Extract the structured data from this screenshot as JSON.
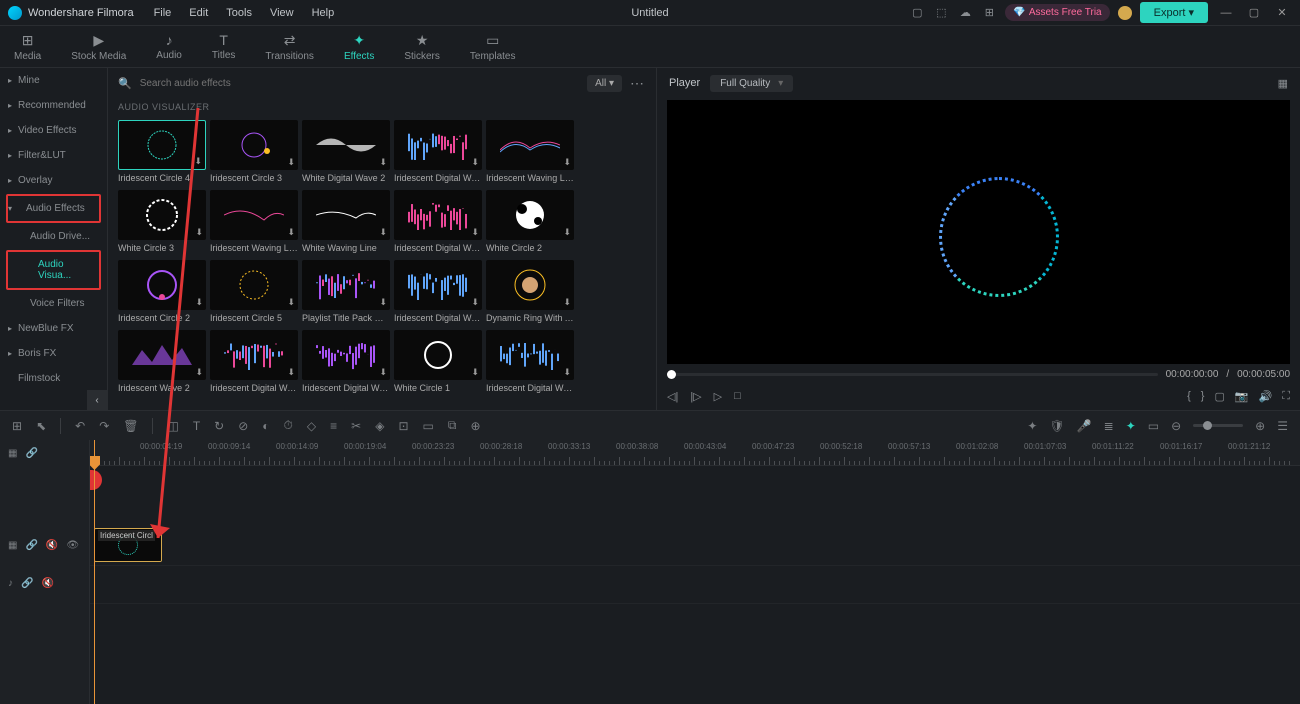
{
  "app": {
    "name": "Wondershare Filmora",
    "title": "Untitled"
  },
  "menu": [
    "File",
    "Edit",
    "Tools",
    "View",
    "Help"
  ],
  "titleRight": {
    "assets": "Assets Free Tria",
    "export": "Export"
  },
  "toolTabs": [
    {
      "label": "Media",
      "icon": "⊞"
    },
    {
      "label": "Stock Media",
      "icon": "▶"
    },
    {
      "label": "Audio",
      "icon": "♪"
    },
    {
      "label": "Titles",
      "icon": "T"
    },
    {
      "label": "Transitions",
      "icon": "⇄"
    },
    {
      "label": "Effects",
      "icon": "✦",
      "active": true
    },
    {
      "label": "Stickers",
      "icon": "★"
    },
    {
      "label": "Templates",
      "icon": "▭"
    }
  ],
  "sidebar": {
    "items": [
      {
        "label": "Mine",
        "expandable": true
      },
      {
        "label": "Recommended",
        "expandable": true
      },
      {
        "label": "Video Effects",
        "expandable": true
      },
      {
        "label": "Filter&LUT",
        "expandable": true
      },
      {
        "label": "Overlay",
        "expandable": true
      },
      {
        "label": "Audio Effects",
        "expandable": true,
        "expanded": true,
        "highlighted": true
      },
      {
        "label": "Audio Drive...",
        "sub": true
      },
      {
        "label": "Audio Visua...",
        "sub": true,
        "selected": true,
        "highlighted": true
      },
      {
        "label": "Voice Filters",
        "sub": true
      },
      {
        "label": "NewBlue FX",
        "expandable": true
      },
      {
        "label": "Boris FX",
        "expandable": true
      },
      {
        "label": "Filmstock"
      }
    ]
  },
  "browser": {
    "searchPlaceholder": "Search audio effects",
    "filterAll": "All",
    "sectionLabel": "AUDIO VISUALIZER",
    "items": [
      {
        "label": "Iridescent Circle 4",
        "selected": true
      },
      {
        "label": "Iridescent Circle 3"
      },
      {
        "label": "White  Digital Wave 2"
      },
      {
        "label": "Iridescent Digital Wav..."
      },
      {
        "label": "Iridescent Waving Line..."
      },
      {
        "label": "White Circle 3"
      },
      {
        "label": "Iridescent Waving Line..."
      },
      {
        "label": "White Waving Line"
      },
      {
        "label": "Iridescent Digital Wav..."
      },
      {
        "label": "White Circle 2"
      },
      {
        "label": "Iridescent Circle 2"
      },
      {
        "label": "Iridescent Circle 5"
      },
      {
        "label": "Playlist Title Pack Musi..."
      },
      {
        "label": "Iridescent Digital Wav..."
      },
      {
        "label": "Dynamic Ring With Ai ..."
      },
      {
        "label": "Iridescent Wave 2"
      },
      {
        "label": "Iridescent Digital Wav..."
      },
      {
        "label": "Iridescent Digital Wav..."
      },
      {
        "label": "White Circle 1"
      },
      {
        "label": "Iridescent Digital Wav..."
      }
    ]
  },
  "preview": {
    "tab": "Player",
    "quality": "Full Quality",
    "current": "00:00:00:00",
    "duration": "00:00:05:00"
  },
  "timeline": {
    "ticks": [
      "00:00:04:19",
      "00:00:09:14",
      "00:00:14:09",
      "00:00:19:04",
      "00:00:23:23",
      "00:00:28:18",
      "00:00:33:13",
      "00:00:38:08",
      "00:00:43:04",
      "00:00:47:23",
      "00:00:52:18",
      "00:00:57:13",
      "00:01:02:08",
      "00:01:07:03",
      "00:01:11:22",
      "00:01:16:17",
      "00:01:21:12"
    ],
    "clipLabel": "Iridescent Circl"
  }
}
